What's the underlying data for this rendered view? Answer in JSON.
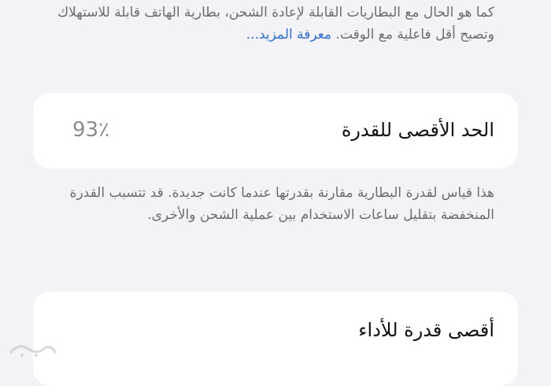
{
  "intro": {
    "text": "كما هو الحال مع البطاريات القابلة لإعادة الشحن، بطارية الهاتف قابلة للاستهلاك وتصبح أقل فاعلية مع الوقت.",
    "learn_more": "معرفة المزيد..."
  },
  "max_capacity": {
    "label": "الحد الأقصى للقدرة",
    "value": "93٪",
    "description": "هذا قياس لقدرة البطارية مقارنة بقدرتها عندما كانت جديدة. قد تتسبب القدرة المنخفضة بتقليل ساعات الاستخدام بين عملية الشحن والأخرى."
  },
  "peak_performance": {
    "label": "أقصى قدرة للأداء"
  },
  "colors": {
    "background": "#f2f2f7",
    "card": "#ffffff",
    "link": "#2f6fd6",
    "secondary_text": "#6b6b70"
  }
}
